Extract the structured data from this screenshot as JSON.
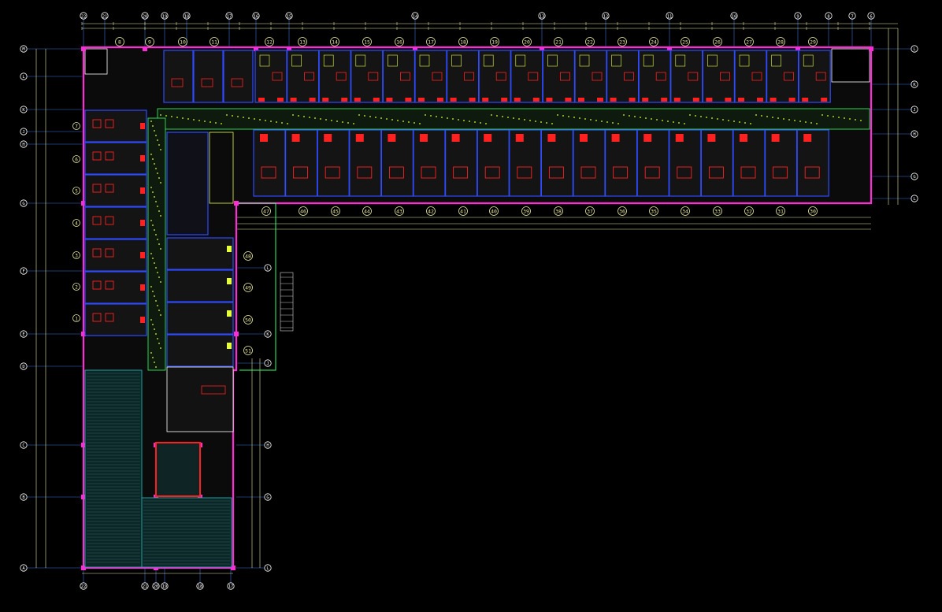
{
  "drawing": {
    "colors": {
      "background": "#000000",
      "grid_axis": "#3b6fd6",
      "dimension": "#e8e8a0",
      "exterior_wall": "#ff2bd6",
      "partition_wall": "#2f4bff",
      "corridor_fixture": "#e6ff3a",
      "door_red": "#ff2020",
      "fill_green": "#33ff66",
      "hatch_cyan": "#1aa3a3",
      "white_text": "#ffffff"
    },
    "top_axis_labels": [
      "22",
      "21",
      "20",
      "19",
      "18",
      "17",
      "16",
      "15",
      "14",
      "13",
      "12",
      "11",
      "10",
      "9",
      "8",
      "7",
      "6",
      "5",
      "4",
      "3",
      "2",
      "1",
      "0"
    ],
    "top_room_numbers": [
      "8",
      "9",
      "10",
      "11",
      "12",
      "13",
      "14",
      "15",
      "16",
      "17",
      "18",
      "19",
      "20",
      "21",
      "22",
      "23",
      "24",
      "25",
      "26",
      "27",
      "28",
      "29"
    ],
    "bottom_room_numbers": [
      "47",
      "46",
      "45",
      "44",
      "43",
      "42",
      "41",
      "40",
      "39",
      "38",
      "37",
      "36",
      "35",
      "34",
      "33",
      "32",
      "31",
      "30"
    ],
    "side_room_numbers": [
      "48",
      "49",
      "50",
      "51"
    ],
    "left_axis_labels": [
      "M",
      "L",
      "K",
      "J",
      "H",
      "G",
      "F",
      "E",
      "D",
      "C",
      "B",
      "A"
    ],
    "left_unit_numbers": [
      "7",
      "6",
      "5",
      "4",
      "3",
      "2",
      "1"
    ],
    "right_axis_labels": [
      "L",
      "K",
      "J",
      "H",
      "G"
    ],
    "bottom_axis_labels": [
      "22",
      "21",
      "20",
      "19",
      "18",
      "17"
    ]
  }
}
